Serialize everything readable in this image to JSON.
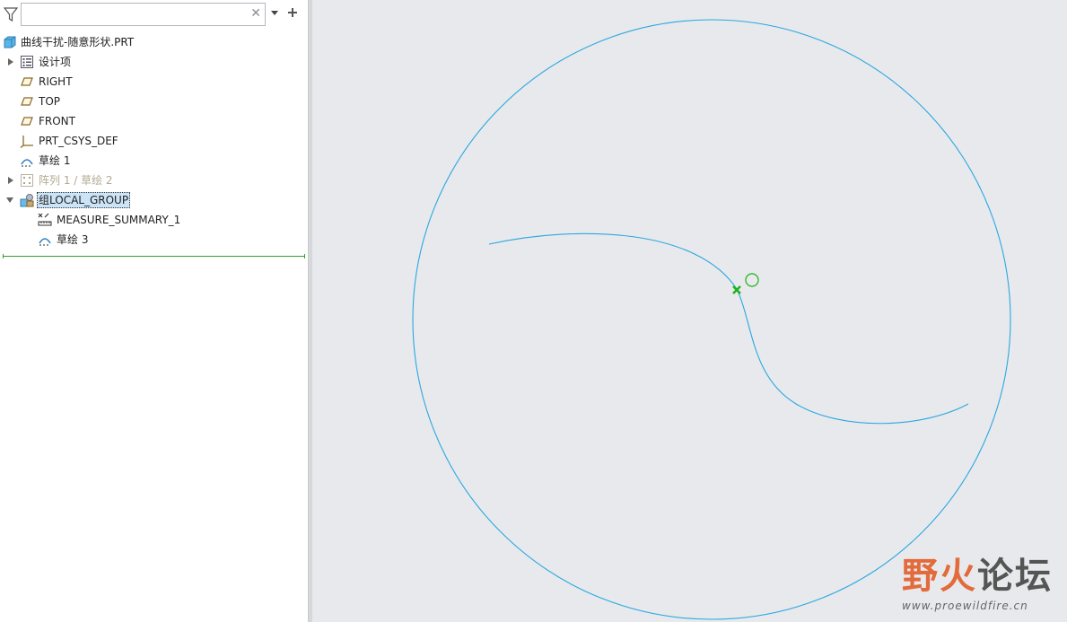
{
  "search": {
    "placeholder": "",
    "value": ""
  },
  "tree": {
    "root": {
      "label": "曲线干扰-随意形状.PRT",
      "icon": "part-icon"
    },
    "items": [
      {
        "label": "设计项",
        "icon": "design-items-icon",
        "expandable": true,
        "expanded": false
      },
      {
        "label": "RIGHT",
        "icon": "datum-plane-icon"
      },
      {
        "label": "TOP",
        "icon": "datum-plane-icon"
      },
      {
        "label": "FRONT",
        "icon": "datum-plane-icon"
      },
      {
        "label": "PRT_CSYS_DEF",
        "icon": "coordinate-system-icon"
      },
      {
        "label": "草绘 1",
        "icon": "sketch-icon"
      },
      {
        "label": "阵列 1 / 草绘 2",
        "icon": "pattern-icon",
        "expandable": true,
        "expanded": false,
        "suppressed": true
      },
      {
        "label": "组LOCAL_GROUP",
        "icon": "group-icon",
        "expandable": true,
        "expanded": true,
        "selected": true
      },
      {
        "label": "MEASURE_SUMMARY_1",
        "icon": "measure-icon",
        "child": true
      },
      {
        "label": "草绘 3",
        "icon": "sketch-icon",
        "child": true
      }
    ]
  },
  "graphics": {
    "curve_color": "#29a8e0",
    "point_color": "#19b319"
  },
  "watermark": {
    "title_part1": "野火",
    "title_part2": "论坛",
    "url": "www.proewildfire.cn"
  }
}
